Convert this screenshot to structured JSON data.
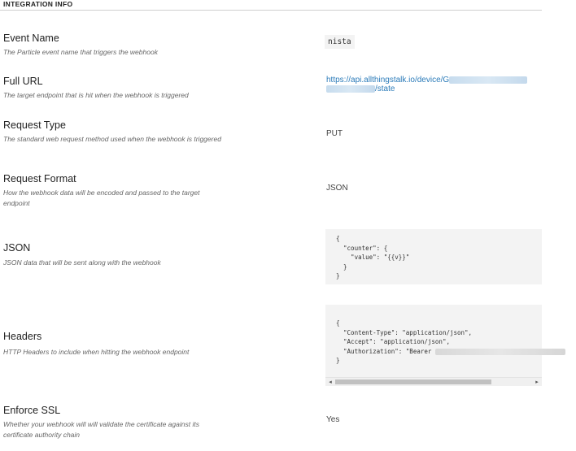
{
  "section": {
    "title": "INTEGRATION INFO"
  },
  "fields": {
    "event_name": {
      "label": "Event Name",
      "description": "The Particle event name that triggers the webhook",
      "value": "nista"
    },
    "full_url": {
      "label": "Full URL",
      "description": "The target endpoint that is hit when the webhook is triggered",
      "value_prefix": "https://api.allthingstalk.io/device/G",
      "value_suffix": "/state"
    },
    "request_type": {
      "label": "Request Type",
      "description": "The standard web request method used when the webhook is triggered",
      "value": "PUT"
    },
    "request_format": {
      "label": "Request Format",
      "description": "How the webhook data will be encoded and passed to the target endpoint",
      "value": "JSON"
    },
    "json": {
      "label": "JSON",
      "description": "JSON data that will be sent along with the webhook",
      "code_lines": [
        "{",
        "  \"counter\": {",
        "    \"value\": \"{{v}}\"",
        "  }",
        "}"
      ]
    },
    "headers": {
      "label": "Headers",
      "description": "HTTP Headers to include when hitting the webhook endpoint",
      "code_lines": [
        "{",
        "  \"Content-Type\": \"application/json\",",
        "  \"Accept\": \"application/json\",",
        "  \"Authorization\": \"Bearer ",
        "}"
      ],
      "scroll_left_icon": "◂",
      "scroll_right_icon": "▸"
    },
    "enforce_ssl": {
      "label": "Enforce SSL",
      "description": "Whether your webhook will will validate the certificate against its certificate authority chain",
      "value": "Yes"
    }
  }
}
